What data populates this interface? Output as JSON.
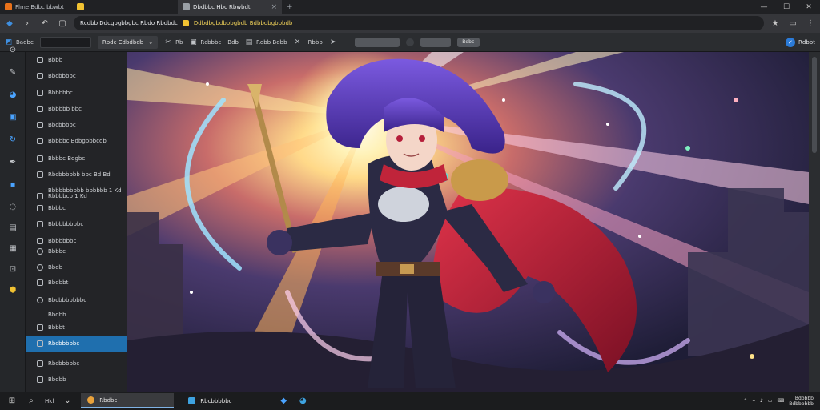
{
  "browser": {
    "tabs": [
      {
        "label": "Flme Bdbc bbwbt",
        "color": "#e8711a"
      },
      {
        "label": "",
        "color": "#f1c232"
      },
      {
        "label": "Dbdbbc Hbc Rbwbdt",
        "color": "#9aa0a6"
      }
    ],
    "new_tab": "+",
    "window_controls": [
      "—",
      "☐",
      "✕"
    ],
    "url_prefix": "Rcdbb Ddcgbgbbgbc Rbdo Rbdbdc",
    "url_highlight": "Ddbdbgbdbbbgbdb Bdbbdbgbbbdb",
    "url_suffix": ""
  },
  "toolbar": {
    "search_label": "Badbc",
    "mode_dropdown": "Rbdc Cdbdbdb",
    "items": [
      {
        "icon": "scissors-icon",
        "label": "Rb"
      },
      {
        "icon": "image-icon",
        "label": "Rcbbbc"
      },
      {
        "icon": "crop-icon",
        "label": "Bdb"
      },
      {
        "icon": "frame-icon",
        "label": "Rdbb Bdbb"
      },
      {
        "icon": "x-icon",
        "label": ""
      },
      {
        "icon": "text-icon",
        "label": "Rbbb"
      },
      {
        "icon": "pointer-icon",
        "label": ""
      }
    ],
    "pill_label": "Bdbc",
    "profile_label": "Rdbbt"
  },
  "rail": [
    "play-icon",
    "brush-icon",
    "paint-bucket-icon",
    "layer-icon",
    "refresh-icon",
    "pen-icon",
    "square-icon",
    "lasso-icon",
    "image-icon",
    "grid-icon",
    "export-icon",
    "star-icon"
  ],
  "sidebar": {
    "items": [
      {
        "label": "Bbbb",
        "icon": "checkbox"
      },
      {
        "label": "Bbcbbbbc",
        "icon": "checkbox"
      },
      {
        "label": "Bbbbbbc",
        "icon": "checkbox"
      },
      {
        "label": "Bbbbbb bbc",
        "icon": "checkbox"
      },
      {
        "label": "Bbcbbbbc",
        "icon": "checkbox"
      },
      {
        "label": "Bbbbbc Bdbgbbbcdb",
        "icon": "checkbox"
      },
      {
        "label": "Bbbbc Bdgbc",
        "icon": "checkbox"
      },
      {
        "label": "Rbcbbbbbb bbc Bd Bd",
        "icon": "checkbox"
      },
      {
        "label": "Bbbbbbbbbb bbbbbb 1 Kd",
        "icon": "none"
      },
      {
        "label": "Rbbbbcb 1 Kd",
        "icon": "checkbox"
      },
      {
        "label": "Bbbbc",
        "icon": "checkbox"
      },
      {
        "label": "Bbbbbbbbbc",
        "icon": "checkbox"
      },
      {
        "label": "Bbbbbbbc",
        "icon": "checkbox"
      },
      {
        "label": "Bbbbc",
        "icon": "round"
      },
      {
        "label": "Bbdb",
        "icon": "round"
      },
      {
        "label": "Bbdbbt",
        "icon": "checkbox"
      },
      {
        "label": "Bbcbbbbbbbc",
        "icon": "round"
      },
      {
        "label": "Bbdbb",
        "icon": "none"
      },
      {
        "label": "Bbbbt",
        "icon": "checkbox"
      },
      {
        "label": "Rbcbbbbbc",
        "icon": "checkbox"
      },
      {
        "label": "Rbcbbbbbc",
        "icon": "checkbox"
      },
      {
        "label": "Bbdbb",
        "icon": "checkbox"
      }
    ],
    "active_index": 19
  },
  "taskbar": {
    "search_label": "Hkl",
    "apps": [
      {
        "label": "Rbdbc",
        "active": true,
        "color": "#e9a23b"
      },
      {
        "label": "Rbcbbbbbc",
        "active": false,
        "color": "#3ea3e0"
      }
    ],
    "clock_time": "Bdbbbb",
    "clock_date": "Bdbbbbbb"
  },
  "colors": {
    "accent": "#1f6fae",
    "cape_red": "#c0243a",
    "hair_purple": "#5b3bb8",
    "glow_yellow": "#fff6c8"
  }
}
